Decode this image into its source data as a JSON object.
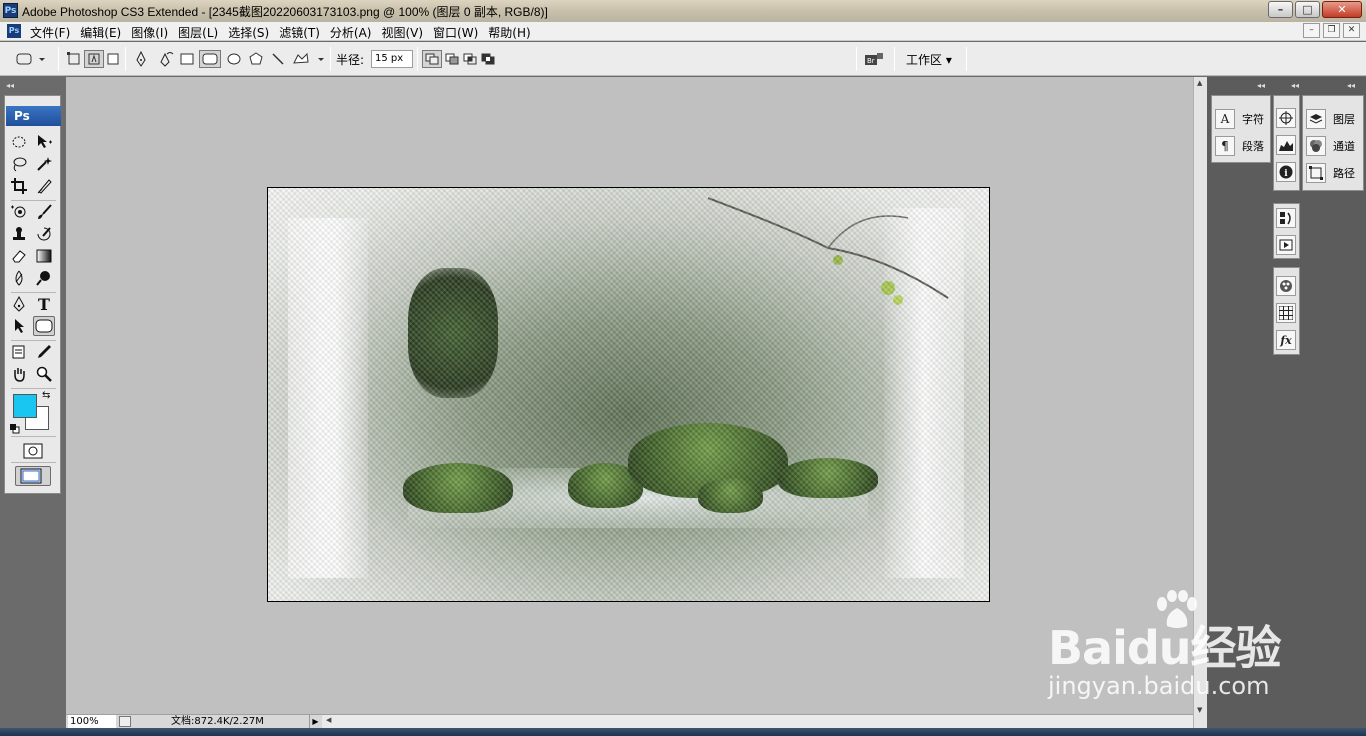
{
  "window": {
    "title": "Adobe Photoshop CS3 Extended - [2345截图20220603173103.png @ 100% (图层 0 副本, RGB/8)]",
    "app_logo": "Ps",
    "controls": [
      "–",
      "□",
      "✕"
    ]
  },
  "menubar": {
    "doc_icon": "Ps",
    "items": [
      "文件(F)",
      "编辑(E)",
      "图像(I)",
      "图层(L)",
      "选择(S)",
      "滤镜(T)",
      "分析(A)",
      "视图(V)",
      "窗口(W)",
      "帮助(H)"
    ],
    "mdi_controls": [
      "–",
      "❐",
      "✕"
    ]
  },
  "options": {
    "radius_label": "半径:",
    "radius_value": "15 px",
    "workspace_label": "工作区 ▾",
    "icons": [
      "rounded-rect-preset-icon",
      "shape-layers-icon",
      "paths-icon",
      "fill-pixels-icon",
      "pen-icon",
      "freeform-pen-icon",
      "rectangle-icon",
      "rounded-rectangle-icon",
      "ellipse-icon",
      "polygon-icon",
      "line-icon",
      "custom-shape-icon",
      "combine-icon",
      "subtract-icon",
      "intersect-icon",
      "exclude-icon",
      "bridge-icon"
    ]
  },
  "toolbox": {
    "logo": "Ps",
    "fg_color": "#19c6f2",
    "bg_color": "#ffffff"
  },
  "panels": {
    "col1": [
      {
        "icon": "A",
        "label": "字符"
      },
      {
        "icon": "¶",
        "label": "段落"
      }
    ],
    "col3": [
      {
        "icon": "layers",
        "label": "图层"
      },
      {
        "icon": "channels",
        "label": "通道"
      },
      {
        "icon": "paths",
        "label": "路径"
      }
    ]
  },
  "status": {
    "zoom": "100%",
    "doc_info": "文档:872.4K/2.27M"
  },
  "watermark": {
    "brand": "Baidu经验",
    "url": "jingyan.baidu.com"
  }
}
